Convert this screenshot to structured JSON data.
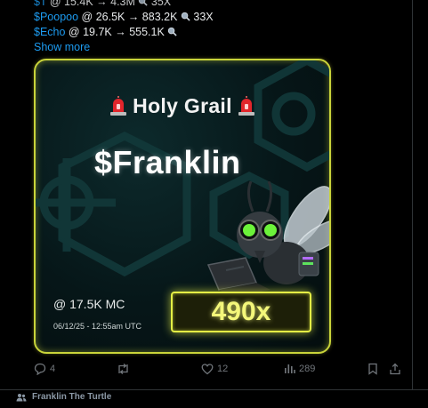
{
  "tweet": {
    "lines": [
      {
        "ticker": "$T",
        "rest": " @ 15.4K → 4.3M",
        "tail": " 35X"
      },
      {
        "ticker": "$Poopoo",
        "rest": " @ 26.5K → 883.2K",
        "tail": " 33X"
      },
      {
        "ticker": "$Echo",
        "rest": " @ 19.7K → 555.1K",
        "tail": ""
      }
    ],
    "show_more": "Show more"
  },
  "card": {
    "title": "Holy Grail",
    "ticker": "$Franklin",
    "market_cap": "@ 17.5K MC",
    "timestamp": "06/12/25 - 12:55am UTC",
    "multiplier": "490x",
    "border_color": "#c9d43a",
    "glow_color": "#e4ee45"
  },
  "actions": {
    "replies": "4",
    "reposts": "",
    "likes": "12",
    "views": "289"
  },
  "footer": {
    "label": "Franklin The Turtle"
  },
  "icons": [
    "magnifier-icon",
    "siren-icon",
    "reply-icon",
    "repost-icon",
    "like-icon",
    "views-icon",
    "bookmark-icon",
    "share-icon",
    "people-icon"
  ]
}
